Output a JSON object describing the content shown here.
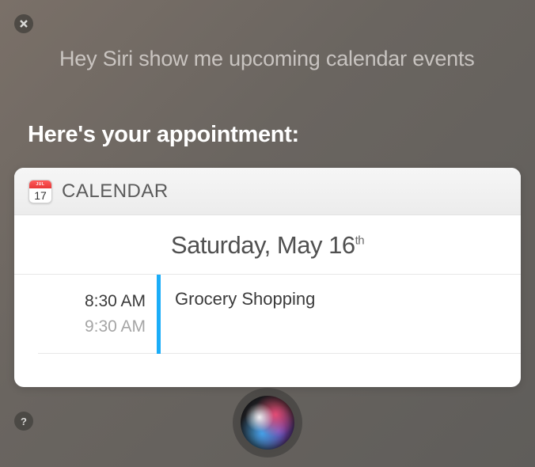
{
  "query": "Hey Siri show me upcoming calendar events",
  "response_heading": "Here's your appointment:",
  "card": {
    "app_label": "CALENDAR",
    "icon_month": "JUL",
    "icon_day": "17",
    "date_main": "Saturday, May 16",
    "date_suffix": "th",
    "event": {
      "start": "8:30 AM",
      "end": "9:30 AM",
      "title": "Grocery Shopping",
      "accent_color": "#1badf8"
    }
  },
  "help_label": "?"
}
